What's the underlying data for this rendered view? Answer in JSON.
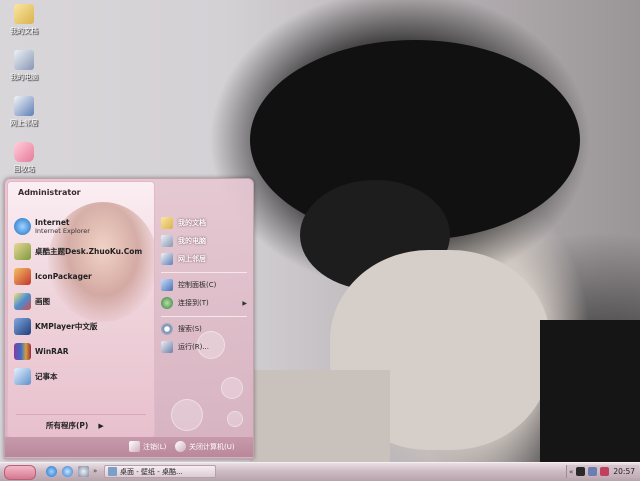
{
  "desktop": {
    "icons": [
      {
        "label": "我的文档",
        "icon": "folder-icon"
      },
      {
        "label": "我的电脑",
        "icon": "computer-icon"
      },
      {
        "label": "网上邻居",
        "icon": "network-icon"
      },
      {
        "label": "回收站",
        "icon": "recycle-bin-icon"
      }
    ]
  },
  "start_menu": {
    "user": "Administrator",
    "pinned": [
      {
        "name": "Internet",
        "sub": "Internet Explorer",
        "icon": "ie-icon"
      },
      {
        "name": "桌酷主题Desk.ZhuoKu.Com",
        "icon": "zhuoku-icon"
      },
      {
        "name": "IconPackager",
        "icon": "iconpackager-icon"
      },
      {
        "name": "画图",
        "icon": "paint-icon"
      },
      {
        "name": "KMPlayer中文版",
        "icon": "kmplayer-icon"
      },
      {
        "name": "WinRAR",
        "icon": "winrar-icon"
      },
      {
        "name": "记事本",
        "icon": "notepad-icon"
      }
    ],
    "all_programs": "所有程序(P)",
    "right": [
      {
        "label": "我的文档",
        "icon": "folder-icon"
      },
      {
        "label": "我的电脑",
        "icon": "computer-icon"
      },
      {
        "label": "网上邻居",
        "icon": "network-icon"
      },
      {
        "label": "控制面板(C)",
        "icon": "control-panel-icon"
      },
      {
        "label": "连接到(T)",
        "icon": "connect-icon"
      },
      {
        "label": "搜索(S)",
        "icon": "search-icon"
      },
      {
        "label": "运行(R)...",
        "icon": "run-icon"
      }
    ],
    "logoff": "注销(L)",
    "shutdown": "关闭计算机(U)"
  },
  "taskbar": {
    "task_label": "桌面 - 壁纸 - 桌酷...",
    "clock": "20:57"
  }
}
